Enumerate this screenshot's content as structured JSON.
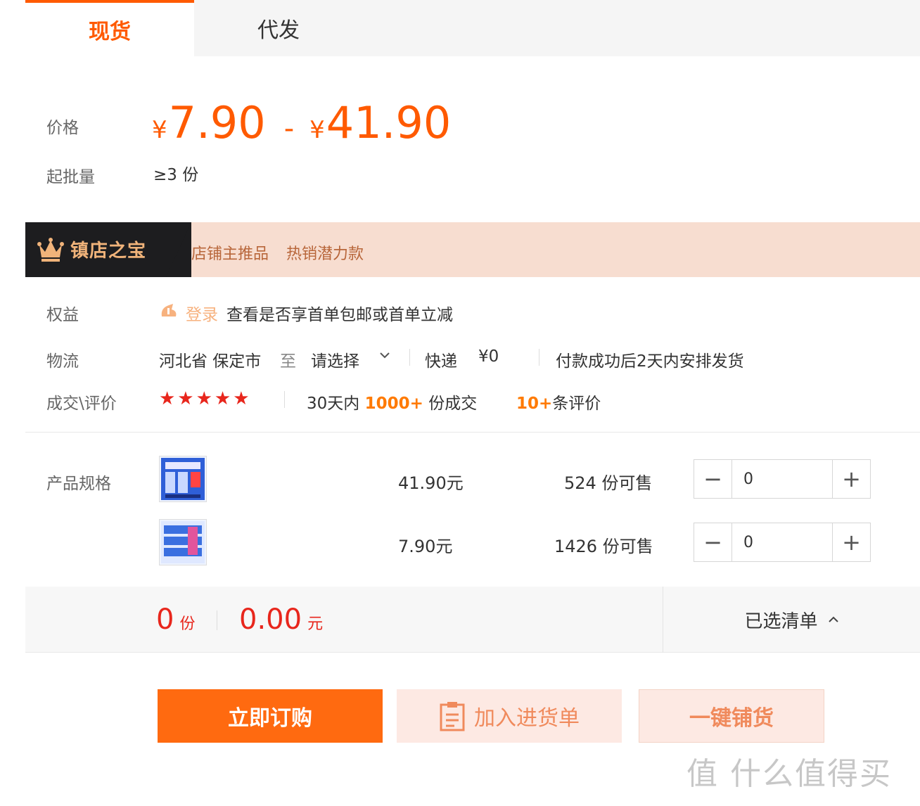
{
  "tabs": [
    {
      "label": "现货",
      "active": true
    },
    {
      "label": "代发",
      "active": false
    }
  ],
  "price": {
    "label": "价格",
    "currency": "¥",
    "low": "7.90",
    "separator": "-",
    "high": "41.90"
  },
  "moq": {
    "label": "起批量",
    "value": "≥3 份"
  },
  "banner": {
    "icon": "crown-icon",
    "title": "镇店之宝",
    "tags": [
      "店铺主推品",
      "热销潜力款"
    ]
  },
  "benefits": {
    "label": "权益",
    "login_link": "登录",
    "text": "查看是否享首单包邮或首单立减"
  },
  "logistics": {
    "label": "物流",
    "origin": "河北省 保定市",
    "to": "至",
    "destination": "请选择",
    "method": "快递",
    "fee": "¥0",
    "shipping_note": "付款成功后2天内安排发货"
  },
  "reviews": {
    "label": "成交\\评价",
    "stars": "★★★★★",
    "rating": 5,
    "sales_prefix": "30天内",
    "sales_count": "1000+",
    "sales_suffix": "份成交",
    "review_count": "10+",
    "review_suffix": "条评价"
  },
  "specs": {
    "label": "产品规格",
    "items": [
      {
        "price": "41.90元",
        "stock": "524 份可售",
        "quantity": "0"
      },
      {
        "price": "7.90元",
        "stock": "1426 份可售",
        "quantity": "0"
      }
    ]
  },
  "summary": {
    "count": "0",
    "count_unit": "份",
    "amount": "0.00",
    "amount_unit": "元",
    "selected_list": "已选清单"
  },
  "buttons": {
    "order": "立即订购",
    "add_cart": "加入进货单",
    "distribute": "一键铺货"
  },
  "watermark": "值 什么值得买",
  "colors": {
    "accent": "#ff5a00",
    "price_red": "#e8261c",
    "banner_bg": "#f7ddd0"
  }
}
